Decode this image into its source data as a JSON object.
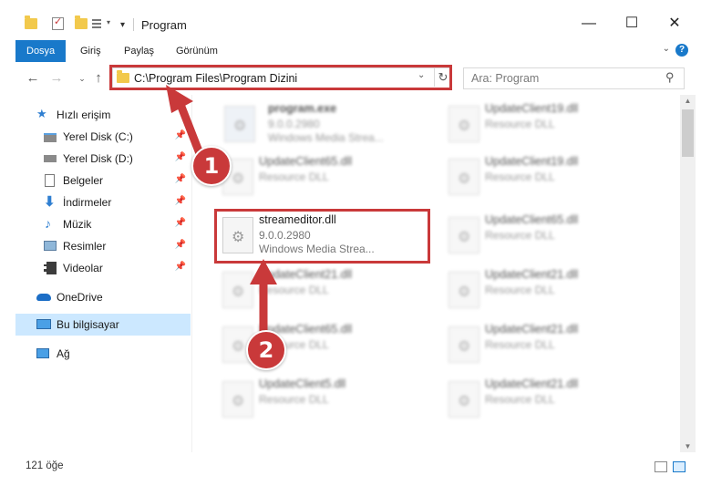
{
  "window": {
    "title": "Program",
    "minimize_glyph": "—",
    "maximize_glyph": "☐",
    "close_glyph": "✕"
  },
  "ribbon": {
    "tabs": [
      {
        "label": "Dosya",
        "active": true
      },
      {
        "label": "Giriş",
        "active": false
      },
      {
        "label": "Paylaş",
        "active": false
      },
      {
        "label": "Görünüm",
        "active": false
      }
    ],
    "help_glyph": "?"
  },
  "nav": {
    "address": "C:\\Program Files\\Program Dizini",
    "search_placeholder": "Ara: Program"
  },
  "sidebar": {
    "items": [
      {
        "label": "Hızlı erişim",
        "icon": "star-icon",
        "pinned": false
      },
      {
        "label": "Yerel Disk (C:)",
        "icon": "drive-icon",
        "pinned": true
      },
      {
        "label": "Yerel Disk (D:)",
        "icon": "drive-icon",
        "pinned": true
      },
      {
        "label": "Belgeler",
        "icon": "documents-icon",
        "pinned": true
      },
      {
        "label": "İndirmeler",
        "icon": "download-icon",
        "pinned": true
      },
      {
        "label": "Müzik",
        "icon": "music-icon",
        "pinned": true
      },
      {
        "label": "Resimler",
        "icon": "pictures-icon",
        "pinned": true
      },
      {
        "label": "Videolar",
        "icon": "video-icon",
        "pinned": true
      },
      {
        "label": "OneDrive",
        "icon": "cloud-icon",
        "pinned": false
      },
      {
        "label": "Bu bilgisayar",
        "icon": "computer-icon",
        "pinned": false,
        "selected": true
      },
      {
        "label": "Ağ",
        "icon": "network-icon",
        "pinned": false
      }
    ]
  },
  "files": {
    "left": [
      {
        "name": "program.exe",
        "line2": "9.0.0.2980",
        "line3": "Windows Media Strea..."
      },
      {
        "name": "UpdateClient65.dll",
        "line2": "Resource DLL",
        "line3": ""
      },
      {
        "name": "streameditor.dll",
        "line2": "9.0.0.2980",
        "line3": "Windows Media Strea..."
      },
      {
        "name": "UpdateClient21.dll",
        "line2": "Resource DLL",
        "line3": ""
      },
      {
        "name": "UpdateClient65.dll",
        "line2": "Resource DLL",
        "line3": ""
      },
      {
        "name": "UpdateClient5.dll",
        "line2": "Resource DLL",
        "line3": ""
      }
    ],
    "right": [
      {
        "name": "UpdateClient19.dll",
        "line2": "Resource DLL"
      },
      {
        "name": "UpdateClient19.dll",
        "line2": "Resource DLL"
      },
      {
        "name": "UpdateClient65.dll",
        "line2": "Resource DLL"
      },
      {
        "name": "UpdateClient21.dll",
        "line2": "Resource DLL"
      },
      {
        "name": "UpdateClient21.dll",
        "line2": "Resource DLL"
      },
      {
        "name": "UpdateClient21.dll",
        "line2": "Resource DLL"
      }
    ]
  },
  "status": {
    "item_count": "121 öğe"
  },
  "annotations": {
    "step1": "1",
    "step2": "2",
    "color": "#c9393a"
  }
}
